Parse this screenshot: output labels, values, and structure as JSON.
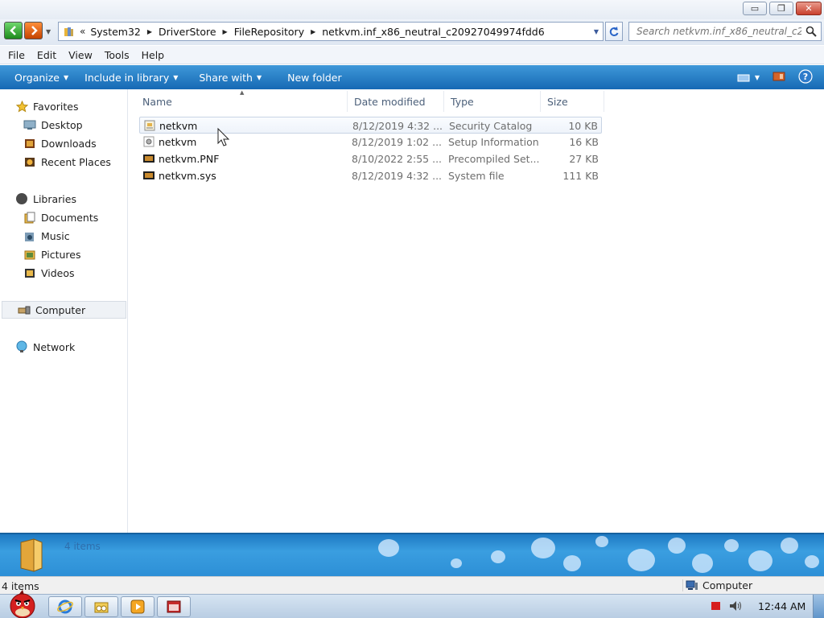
{
  "window": {
    "minimize_glyph": "▭",
    "maximize_glyph": "❐",
    "close_glyph": "✕"
  },
  "address": {
    "lead": "«",
    "crumbs": [
      "System32",
      "DriverStore",
      "FileRepository",
      "netkvm.inf_x86_neutral_c20927049974fdd6"
    ],
    "search_placeholder": "Search netkvm.inf_x86_neutral_c20..."
  },
  "menu": [
    "File",
    "Edit",
    "View",
    "Tools",
    "Help"
  ],
  "commands": {
    "organize": "Organize",
    "include_in_library": "Include in library",
    "share_with": "Share with",
    "new_folder": "New folder"
  },
  "nav": {
    "favorites": "Favorites",
    "desktop": "Desktop",
    "downloads": "Downloads",
    "recent_places": "Recent Places",
    "libraries": "Libraries",
    "documents": "Documents",
    "music": "Music",
    "pictures": "Pictures",
    "videos": "Videos",
    "computer": "Computer",
    "network": "Network"
  },
  "columns": {
    "name": "Name",
    "date": "Date modified",
    "type": "Type",
    "size": "Size"
  },
  "files": [
    {
      "name": "netkvm",
      "date": "8/12/2019 4:32 ...",
      "type": "Security Catalog",
      "size": "10 KB",
      "icon": "security-catalog-icon"
    },
    {
      "name": "netkvm",
      "date": "8/12/2019 1:02 ...",
      "type": "Setup Information",
      "size": "16 KB",
      "icon": "setup-information-icon"
    },
    {
      "name": "netkvm.PNF",
      "date": "8/10/2022 2:55 ...",
      "type": "Precompiled Set...",
      "size": "27 KB",
      "icon": "pnf-file-icon"
    },
    {
      "name": "netkvm.sys",
      "date": "8/12/2019 4:32 ...",
      "type": "System file",
      "size": "111 KB",
      "icon": "system-file-icon"
    }
  ],
  "details": {
    "count": "4 items"
  },
  "status": {
    "left": "4 items",
    "right": "Computer"
  },
  "taskbar": {
    "clock": "12:44 AM"
  },
  "colors": {
    "accent": "#1669b4",
    "details_blue": "#2d8fd6"
  }
}
